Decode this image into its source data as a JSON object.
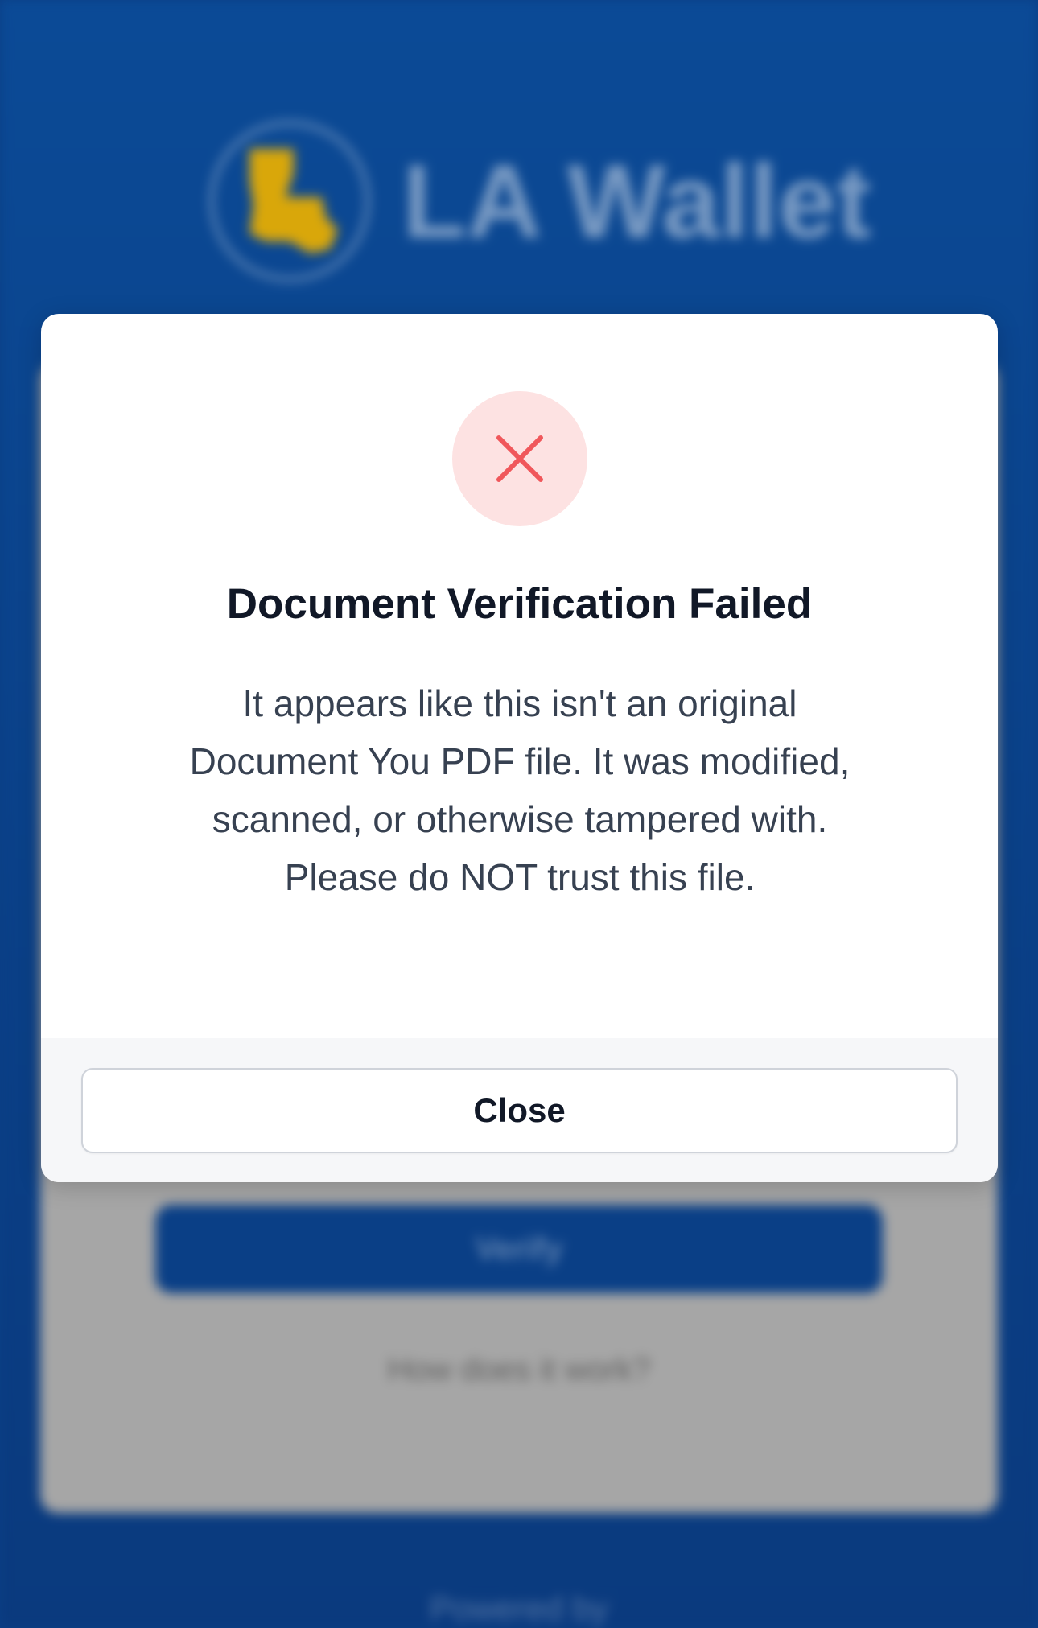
{
  "background": {
    "app_name": "LA Wallet",
    "verify_button_label": "Verify",
    "help_link_label": "How does it work?",
    "powered_by_label": "Powered by",
    "brand_color": "#0b3f86",
    "logo_state_color": "#d9a70a"
  },
  "modal": {
    "icon": "close-x-icon",
    "icon_color": "#f0575b",
    "icon_bg_color": "#fde2e2",
    "title": "Document Verification Failed",
    "message": "It appears like this isn't an original Document You PDF file. It was modified, scanned, or otherwise tampered with. Please do NOT trust this file.",
    "close_label": "Close"
  }
}
